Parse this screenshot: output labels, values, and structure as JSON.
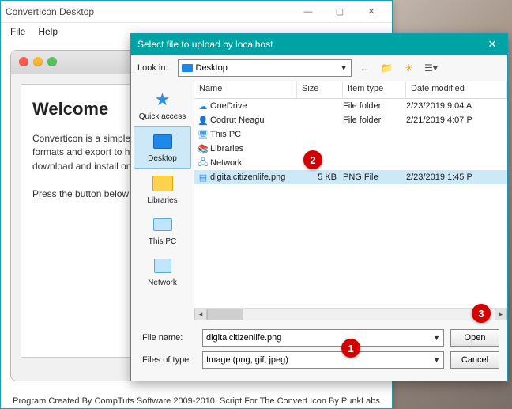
{
  "main_window": {
    "title": "ConvertIcon Desktop",
    "menu": {
      "file": "File",
      "help": "Help"
    },
    "welcome_heading": "Welcome",
    "paragraph1": "Converticon is a simple icon utility. It can import ICO, PNG, GIF, and JPEG formats and export to high-quality PNG or ICO files. There is no software to download and install on your computer.",
    "paragraph2": "Press the button below to get started.",
    "footer": "Program Created By CompTuts Software 2009-2010, Script For The Convert Icon By PunkLabs"
  },
  "dialog": {
    "title": "Select file to upload by localhost",
    "look_in_label": "Look in:",
    "look_in_value": "Desktop",
    "nav_icons": [
      "back",
      "up",
      "new-folder",
      "view"
    ],
    "side_items": [
      {
        "label": "Quick access",
        "icon": "star"
      },
      {
        "label": "Desktop",
        "icon": "desktop",
        "selected": true
      },
      {
        "label": "Libraries",
        "icon": "folder"
      },
      {
        "label": "This PC",
        "icon": "pc"
      },
      {
        "label": "Network",
        "icon": "net"
      }
    ],
    "columns": {
      "name": "Name",
      "size": "Size",
      "type": "Item type",
      "date": "Date modified"
    },
    "rows": [
      {
        "icon": "cloud",
        "name": "OneDrive",
        "size": "",
        "type": "File folder",
        "date": "2/23/2019 9:04 A"
      },
      {
        "icon": "user",
        "name": "Codrut Neagu",
        "size": "",
        "type": "File folder",
        "date": "2/21/2019 4:07 P"
      },
      {
        "icon": "pc",
        "name": "This PC",
        "size": "",
        "type": "",
        "date": ""
      },
      {
        "icon": "lib",
        "name": "Libraries",
        "size": "",
        "type": "",
        "date": ""
      },
      {
        "icon": "net",
        "name": "Network",
        "size": "",
        "type": "",
        "date": ""
      },
      {
        "icon": "img",
        "name": "digitalcitizenlife.png",
        "size": "5 KB",
        "type": "PNG File",
        "date": "2/23/2019 1:45 P",
        "selected": true
      }
    ],
    "file_name_label": "File name:",
    "file_name_value": "digitalcitizenlife.png",
    "file_type_label": "Files of type:",
    "file_type_value": "Image (png, gif, jpeg)",
    "open_btn": "Open",
    "cancel_btn": "Cancel"
  },
  "badges": {
    "b1": "1",
    "b2": "2",
    "b3": "3"
  }
}
